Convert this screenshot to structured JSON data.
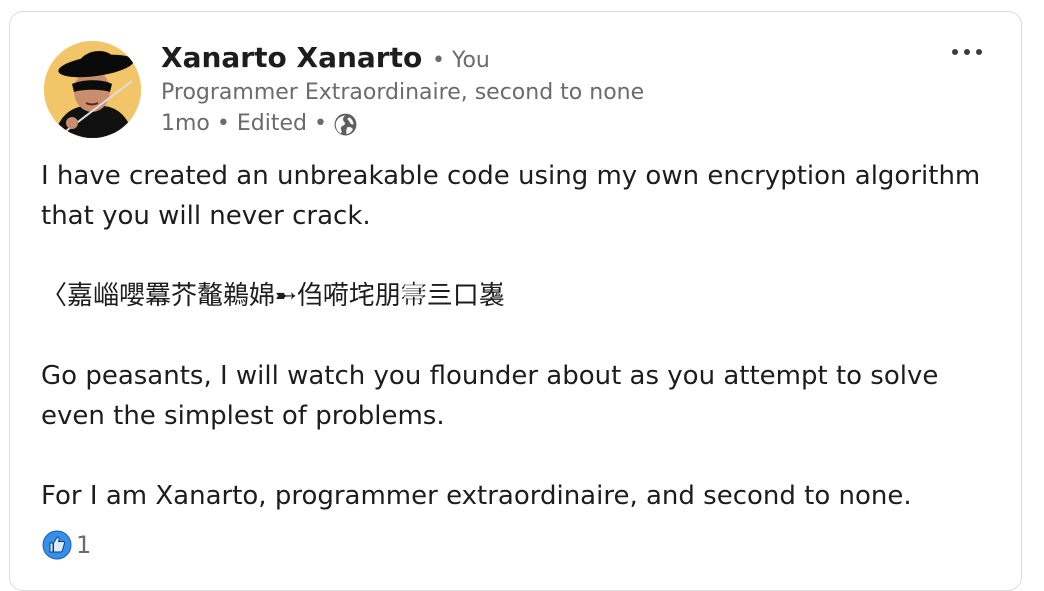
{
  "post": {
    "author": {
      "name": "Xanarto Xanarto",
      "you_label": "• You",
      "headline": "Programmer Extraordinaire, second to none",
      "time": "1mo",
      "edited": "• Edited •",
      "visibility_icon": "globe-icon"
    },
    "menu_icon": "more-horizontal-icon",
    "body": [
      "I have created an unbreakable code using my own encryption algorithm that you will never crack.",
      "〈嘉崰嚶羃芥鼇鵜婂➸㑇嗬垞朋𡨦亖口㠢",
      "Go peasants, I will watch you flounder about as you attempt to solve even the simplest of problems.",
      "For I am Xanarto, programmer extraordinaire, and second to none."
    ],
    "reactions": {
      "icon": "like-icon",
      "count": "1"
    }
  }
}
